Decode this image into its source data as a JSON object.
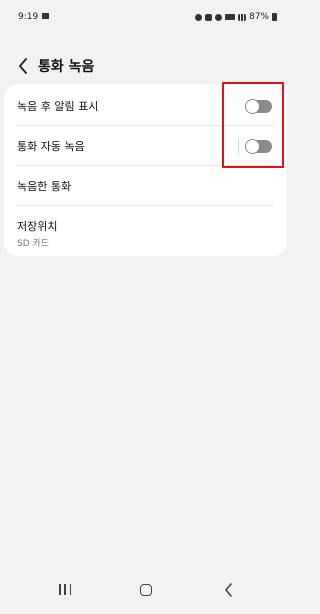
{
  "status_bar": {
    "time": "9:19",
    "battery": "87%",
    "network": "HD"
  },
  "header": {
    "title": "통화 녹음"
  },
  "settings": {
    "items": [
      {
        "label": "녹음 후 알림 표시",
        "toggle": "off"
      },
      {
        "label": "통화 자동 녹음",
        "toggle": "off"
      },
      {
        "label": "녹음한 통화"
      },
      {
        "label": "저장위치",
        "sub": "SD 카드"
      }
    ]
  },
  "colors": {
    "highlight": "#e0131a",
    "toggle_off": "#8a8a8a",
    "card": "#ffffff",
    "background": "#f2f2f2"
  },
  "icons": {
    "back": "chevron-left-icon",
    "recents": "recents-icon",
    "home": "home-icon",
    "nav_back": "nav-back-icon"
  }
}
